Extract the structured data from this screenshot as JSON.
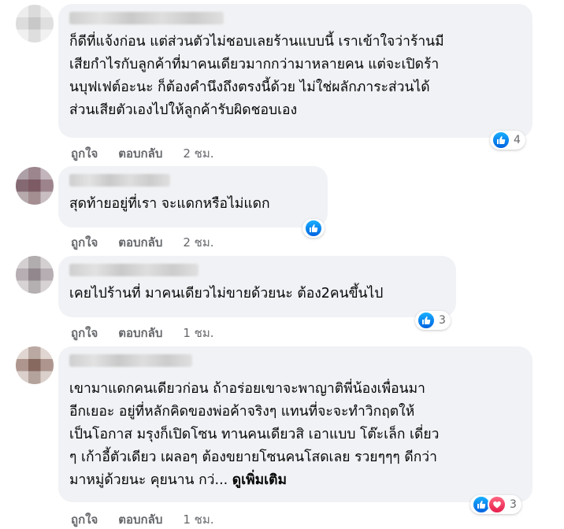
{
  "comments": [
    {
      "text": "ก็ดีที่แจ้งก่อน แต่ส่วนตัวไม่ชอบเลยร้านแบบนี้ เราเข้าใจว่าร้านมี\nเสียกำไรกับลูกค้าที่มาคนเดียวมากกว่ามาหลายคน แต่จะเปิดร้า\nนบุฟเฟต์อะนะ ก็ต้องคำนึงถึงตรงนี้ด้วย ไม่ใช่ผลักภาระส่วนได้\nส่วนเสียตัวเองไปให้ลูกค้ารับผิดชอบเอง",
      "reaction_count": "4",
      "like_label": "ถูกใจ",
      "reply_label": "ตอบกลับ",
      "time": "2 ชม."
    },
    {
      "text": "สุดท้ายอยู่ที่เรา จะแดกหรือไม่แดก",
      "reaction_count": "",
      "like_label": "ถูกใจ",
      "reply_label": "ตอบกลับ",
      "time": "2 ชม."
    },
    {
      "text": "เคยไปร้านที่ มาคนเดียวไม่ขายด้วยนะ ต้อง2คนขึ้นไป",
      "reaction_count": "3",
      "like_label": "ถูกใจ",
      "reply_label": "ตอบกลับ",
      "time": "1 ชม."
    },
    {
      "text": "เขามาแดกคนเดียวก่อน ถ้าอร่อยเขาจะพาญาติพี่น้องเพื่อนมา\nอีกเยอะ อยู่ที่หลักคิดของพ่อค้าจริงๆ แทนที่จะจะทำวิกฤตให้\nเป็นโอกาส มรุงก็เปิดโซน ทานคนเดียวสิ เอาแบบ โต๊ะเล็ก เดี่ยว\nๆ เก้าอี้ตัวเดียว เผลอๆ ต้องขยายโซนคนโสดเลย รวยๆๆๆ ดีกว่า\nมาหมู่ด้วยนะ คุยนาน กว่... ",
      "see_more": "ดูเพิ่มเติม",
      "reaction_count": "3",
      "like_label": "ถูกใจ",
      "reply_label": "ตอบกลับ",
      "time": "1 ชม."
    }
  ],
  "colors": {
    "bubble": "#f0f2f5",
    "meta": "#65676b",
    "like": "#1877f2",
    "love": "#f33e58"
  }
}
